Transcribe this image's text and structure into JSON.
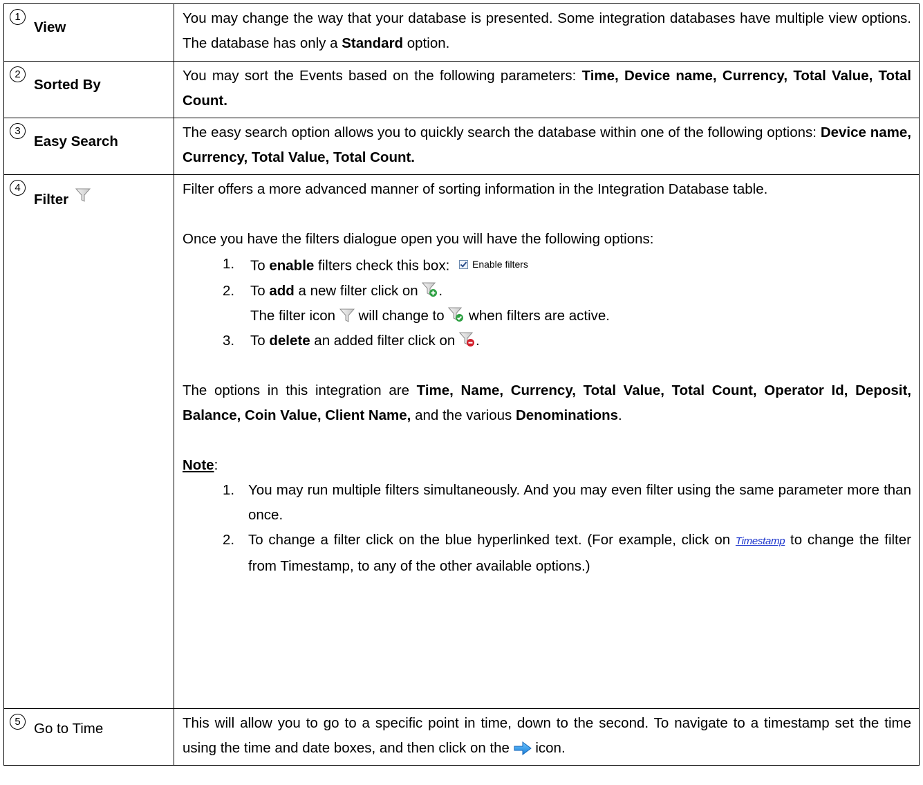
{
  "rows": [
    {
      "number": "1",
      "label": "View",
      "text_prefix": "You may change the way that your database is presented. Some integration databases have multiple view options. The database has only a ",
      "text_bold": "Standard",
      "text_suffix": " option."
    },
    {
      "number": "2",
      "label": "Sorted By",
      "text_prefix": "You may sort the Events based on the following parameters: ",
      "text_bold": "Time, Device name, Currency, Total Value, Total Count."
    },
    {
      "number": "3",
      "label": "Easy Search",
      "text_prefix": "The easy search option allows you to quickly search the database within one of the following options: ",
      "text_bold": "Device name, Currency, Total Value, Total Count."
    },
    {
      "number": "4",
      "label": "Filter",
      "label_icon": "filter-icon",
      "intro": "Filter offers a more advanced manner of sorting information in the Integration Database table.",
      "options_intro": "Once you have the filters dialogue open you will have the following options:",
      "steps": [
        {
          "n": "1.",
          "pre": "To ",
          "bold": "enable",
          "post": " filters check this box:",
          "checkbox_label": "Enable filters"
        },
        {
          "n": "2.",
          "pre": "To ",
          "bold": "add",
          "post": " a new filter click on ",
          "icon": "filter-add-icon",
          "end": "."
        },
        {
          "sub_pre": "The filter icon ",
          "sub_icon1": "filter-icon",
          "sub_mid": " will change to ",
          "sub_icon2": "filter-active-icon",
          "sub_post": " when filters are active."
        },
        {
          "n": "3.",
          "pre": "To ",
          "bold": "delete",
          "post": " an added filter click on ",
          "icon": "filter-delete-icon",
          "end": "."
        }
      ],
      "options": {
        "pre": "The options in this integration are ",
        "bold1": "Time, Name, Currency, Total Value, Total Count, Operator Id, Deposit, Balance, Coin Value, Client Name,",
        "mid": " and the various ",
        "bold2": "Denominations",
        "post": "."
      },
      "note_heading": "Note",
      "note_colon": ":",
      "notes": [
        {
          "n": "1.",
          "text": "You may run multiple filters simultaneously. And you may even filter using the same parameter more than once."
        },
        {
          "n": "2.",
          "pre": "To change a filter click on the blue hyperlinked text. (For example, click on ",
          "link": "Timestamp",
          "post": " to change the filter from Timestamp, to any of the other available options.)"
        }
      ]
    },
    {
      "number": "5",
      "label": "Go to Time",
      "text_prefix": "This will allow you to go to a specific point in time, down to the second. To navigate to a timestamp set the time using the time and date boxes, and then click on the ",
      "icon": "arrow-right-icon",
      "text_suffix": " icon."
    }
  ]
}
